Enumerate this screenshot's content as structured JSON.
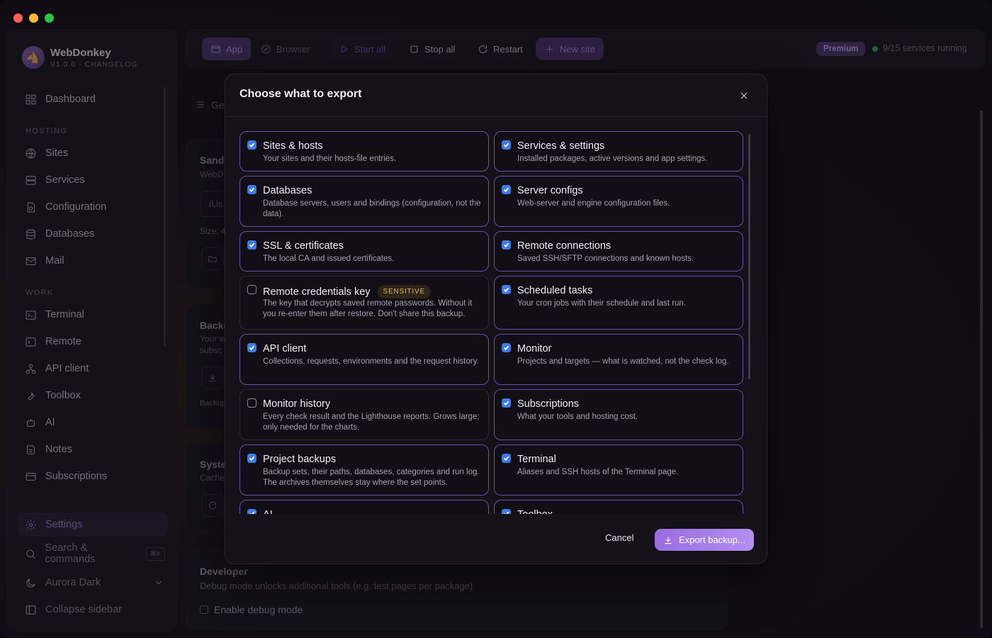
{
  "app": {
    "name": "WebDonkey",
    "version_line": "V1.0.0 · CHANGELOG"
  },
  "sidebar": {
    "dashboard": "Dashboard",
    "section_hosting": "HOSTING",
    "sites": "Sites",
    "services": "Services",
    "configuration": "Configuration",
    "databases": "Databases",
    "mail": "Mail",
    "section_work": "WORK",
    "terminal": "Terminal",
    "remote": "Remote",
    "api_client": "API client",
    "toolbox": "Toolbox",
    "ai": "AI",
    "notes": "Notes",
    "subscriptions": "Subscriptions",
    "settings": "Settings",
    "search": "Search & commands",
    "search_shortcut": "⌘K",
    "theme": "Aurora Dark",
    "collapse": "Collapse sidebar"
  },
  "toolbar": {
    "app": "App",
    "browser": "Browser",
    "start_all": "Start all",
    "stop_all": "Stop all",
    "restart": "Restart",
    "new_site": "New site",
    "premium": "Premium",
    "status": "9/15 services running"
  },
  "background": {
    "tab_partial": "Ge",
    "card1_title": "Sandl",
    "card1_sub": "WebD",
    "card1_path": "/Us",
    "card1_size": "Size: 4",
    "card2_title": "Backu",
    "card2_line1": "Your w",
    "card2_line2": "subsc",
    "card2_foot": "Backup",
    "card3_title": "Syste",
    "card3_sub": "Cache",
    "developer_title": "Developer",
    "developer_desc": "Debug mode unlocks additional tools (e.g. test pages per package)",
    "debug_label": "Enable debug mode"
  },
  "modal": {
    "title": "Choose what to export",
    "cancel": "Cancel",
    "export": "Export backup...",
    "sensitive_badge": "SENSITIVE",
    "options": [
      {
        "title": "Sites & hosts",
        "desc": "Your sites and their hosts-file entries.",
        "checked": true
      },
      {
        "title": "Services & settings",
        "desc": "Installed packages, active versions and app settings.",
        "checked": true
      },
      {
        "title": "Databases",
        "desc": "Database servers, users and bindings (configuration, not the data).",
        "checked": true
      },
      {
        "title": "Server configs",
        "desc": "Web-server and engine configuration files.",
        "checked": true
      },
      {
        "title": "SSL & certificates",
        "desc": "The local CA and issued certificates.",
        "checked": true
      },
      {
        "title": "Remote connections",
        "desc": "Saved SSH/SFTP connections and known hosts.",
        "checked": true
      },
      {
        "title": "Remote credentials key",
        "desc": "The key that decrypts saved remote passwords. Without it you re-enter them after restore. Don't share this backup.",
        "checked": false
      },
      {
        "title": "Scheduled tasks",
        "desc": "Your cron jobs with their schedule and last run.",
        "checked": true
      },
      {
        "title": "API client",
        "desc": "Collections, requests, environments and the request history.",
        "checked": true
      },
      {
        "title": "Monitor",
        "desc": "Projects and targets — what is watched, not the check log.",
        "checked": true
      },
      {
        "title": "Monitor history",
        "desc": "Every check result and the Lighthouse reports. Grows large; only needed for the charts.",
        "checked": false
      },
      {
        "title": "Subscriptions",
        "desc": "What your tools and hosting cost.",
        "checked": true
      },
      {
        "title": "Project backups",
        "desc": "Backup sets, their paths, databases, categories and run log. The archives themselves stay where the set points.",
        "checked": true
      },
      {
        "title": "Terminal",
        "desc": "Aliases and SSH hosts of the Terminal page.",
        "checked": true
      },
      {
        "title": "AI",
        "desc": "",
        "checked": true
      },
      {
        "title": "Toolbox",
        "desc": "",
        "checked": true
      }
    ]
  }
}
